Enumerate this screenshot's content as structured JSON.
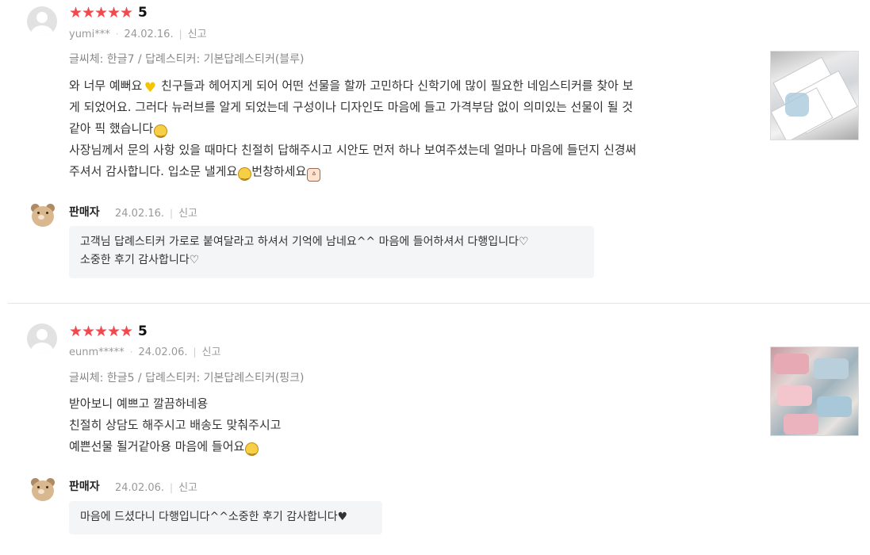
{
  "reviews": [
    {
      "rating": "5",
      "stars": 5,
      "user": "yumi***",
      "date": "24.02.16.",
      "report_label": "신고",
      "option": "글씨체: 한글7 / 답례스티커: 기본답례스티커(블루)",
      "lines": [
        "와 너무 예뻐요",
        " 친구들과 헤어지게 되어 어떤 선물을 할까 고민하다 신학기에 많이 필요한 네임스티커를 찾아 보",
        "게 되었어요. 그러다 뉴러브를 알게 되었는데 구성이나 디자인도 마음에 들고 가격부담 없이 의미있는 선물이 될 것",
        "같아 픽 했습니다",
        "사장님께서 문의 사항 있을 때마다 친절히 답해주시고 시안도 먼저 하나 보여주셨는데 얼마나 마음에 들던지 신경써",
        "주셔서 감사합니다. 입소문 낼게요",
        "번창하세요"
      ],
      "photo_icon": "review-photo-stickers-blue",
      "reply": {
        "author": "판매자",
        "date": "24.02.16.",
        "report_label": "신고",
        "lines": [
          "고객님 답례스티커 가로로 붙여달라고 하셔서 기억에 남네요^^ 마음에 들어하셔서 다행입니다♡",
          "소중한 후기 감사합니다♡"
        ]
      }
    },
    {
      "rating": "5",
      "stars": 5,
      "user": "eunm*****",
      "date": "24.02.06.",
      "report_label": "신고",
      "option": "글씨체: 한글5 / 답례스티커: 기본답례스티커(핑크)",
      "lines": [
        "받아보니 예쁘고 깔끔하네용",
        "친절히 상담도 해주시고 배송도 맞춰주시고",
        "예쁜선물 될거같아용 마음에 들어요"
      ],
      "photo_icon": "review-photo-stickers-pink",
      "reply": {
        "author": "판매자",
        "date": "24.02.06.",
        "report_label": "신고",
        "lines": [
          "마음에 드셨다니 다행입니다^^소중한 후기 감사합니다♥"
        ]
      }
    }
  ],
  "icons": {
    "star": "star-icon",
    "avatar": "default-user-avatar-icon",
    "seller_avatar": "bear-seller-avatar-icon",
    "emoji_heart": "yellow-heart-emoji",
    "emoji_smile": "smiling-face-emoji",
    "emoji_hands": "raising-hands-emoji"
  },
  "colors": {
    "star": "#ee4a50",
    "reply_bg": "#f4f5f7",
    "meta_text": "#999999"
  }
}
